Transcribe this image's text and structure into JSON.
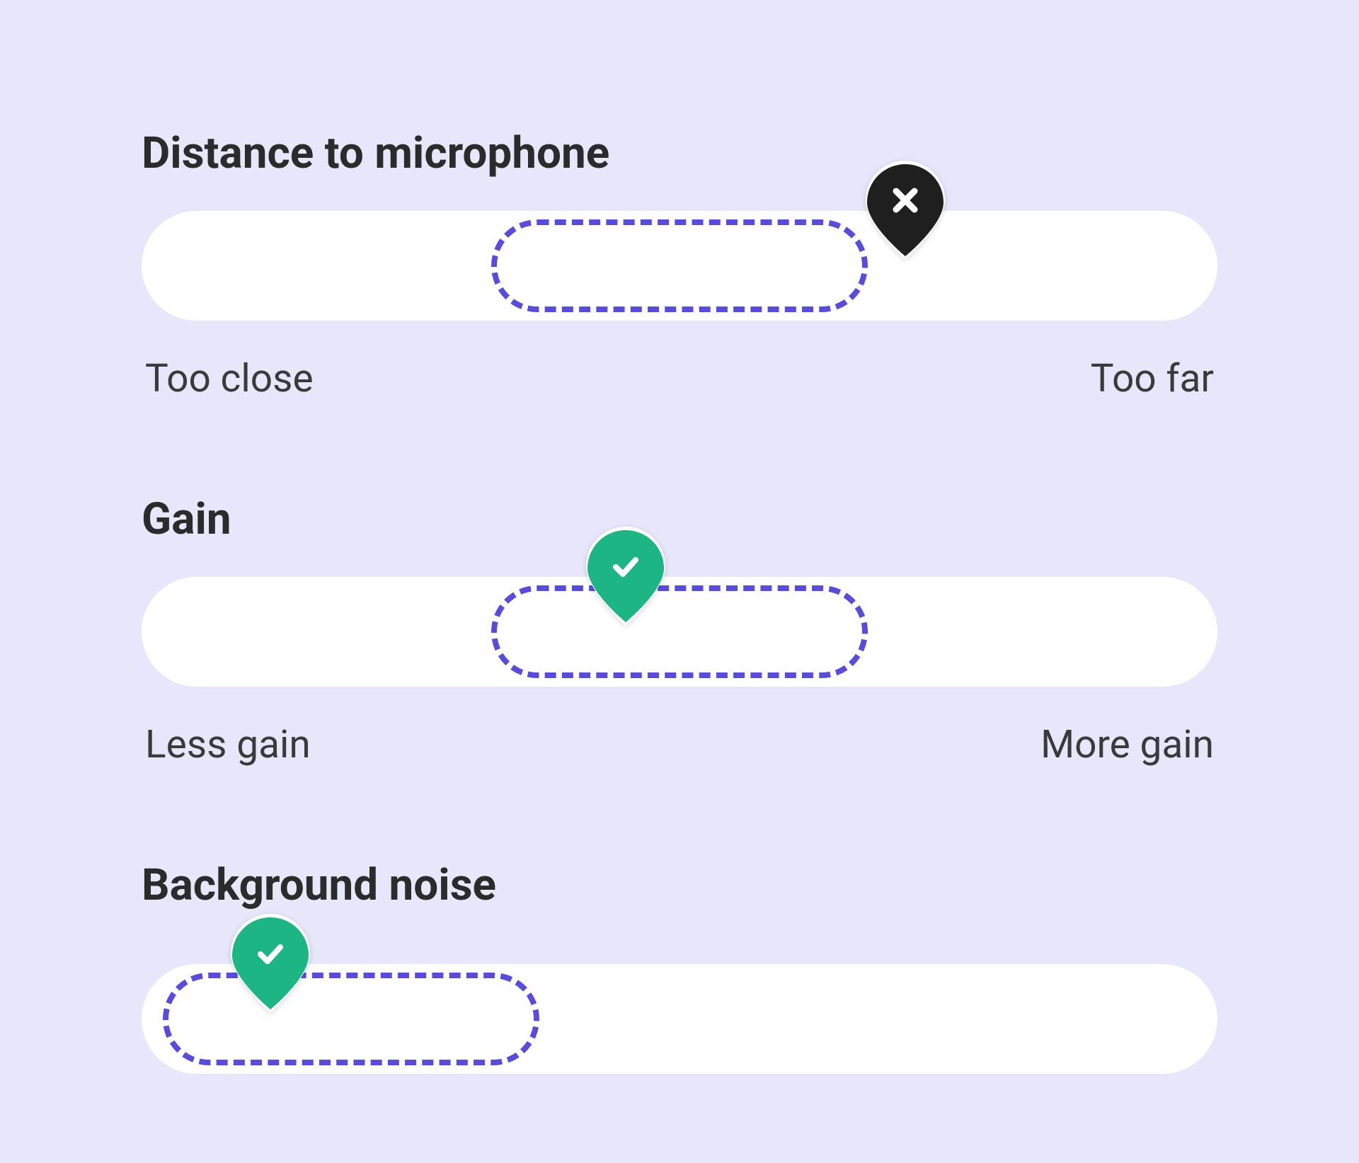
{
  "sections": {
    "distance": {
      "title": "Distance to microphone",
      "label_low": "Too close",
      "label_high": "Too far",
      "status": "error",
      "marker_color": "#1f1f1f",
      "optimal_color": "#5a4cdb"
    },
    "gain": {
      "title": "Gain",
      "label_low": "Less gain",
      "label_high": "More gain",
      "status": "ok",
      "marker_color": "#1db584",
      "optimal_color": "#5a4cdb"
    },
    "noise": {
      "title": "Background noise",
      "status": "ok",
      "marker_color": "#1db584",
      "optimal_color": "#5a4cdb"
    }
  }
}
